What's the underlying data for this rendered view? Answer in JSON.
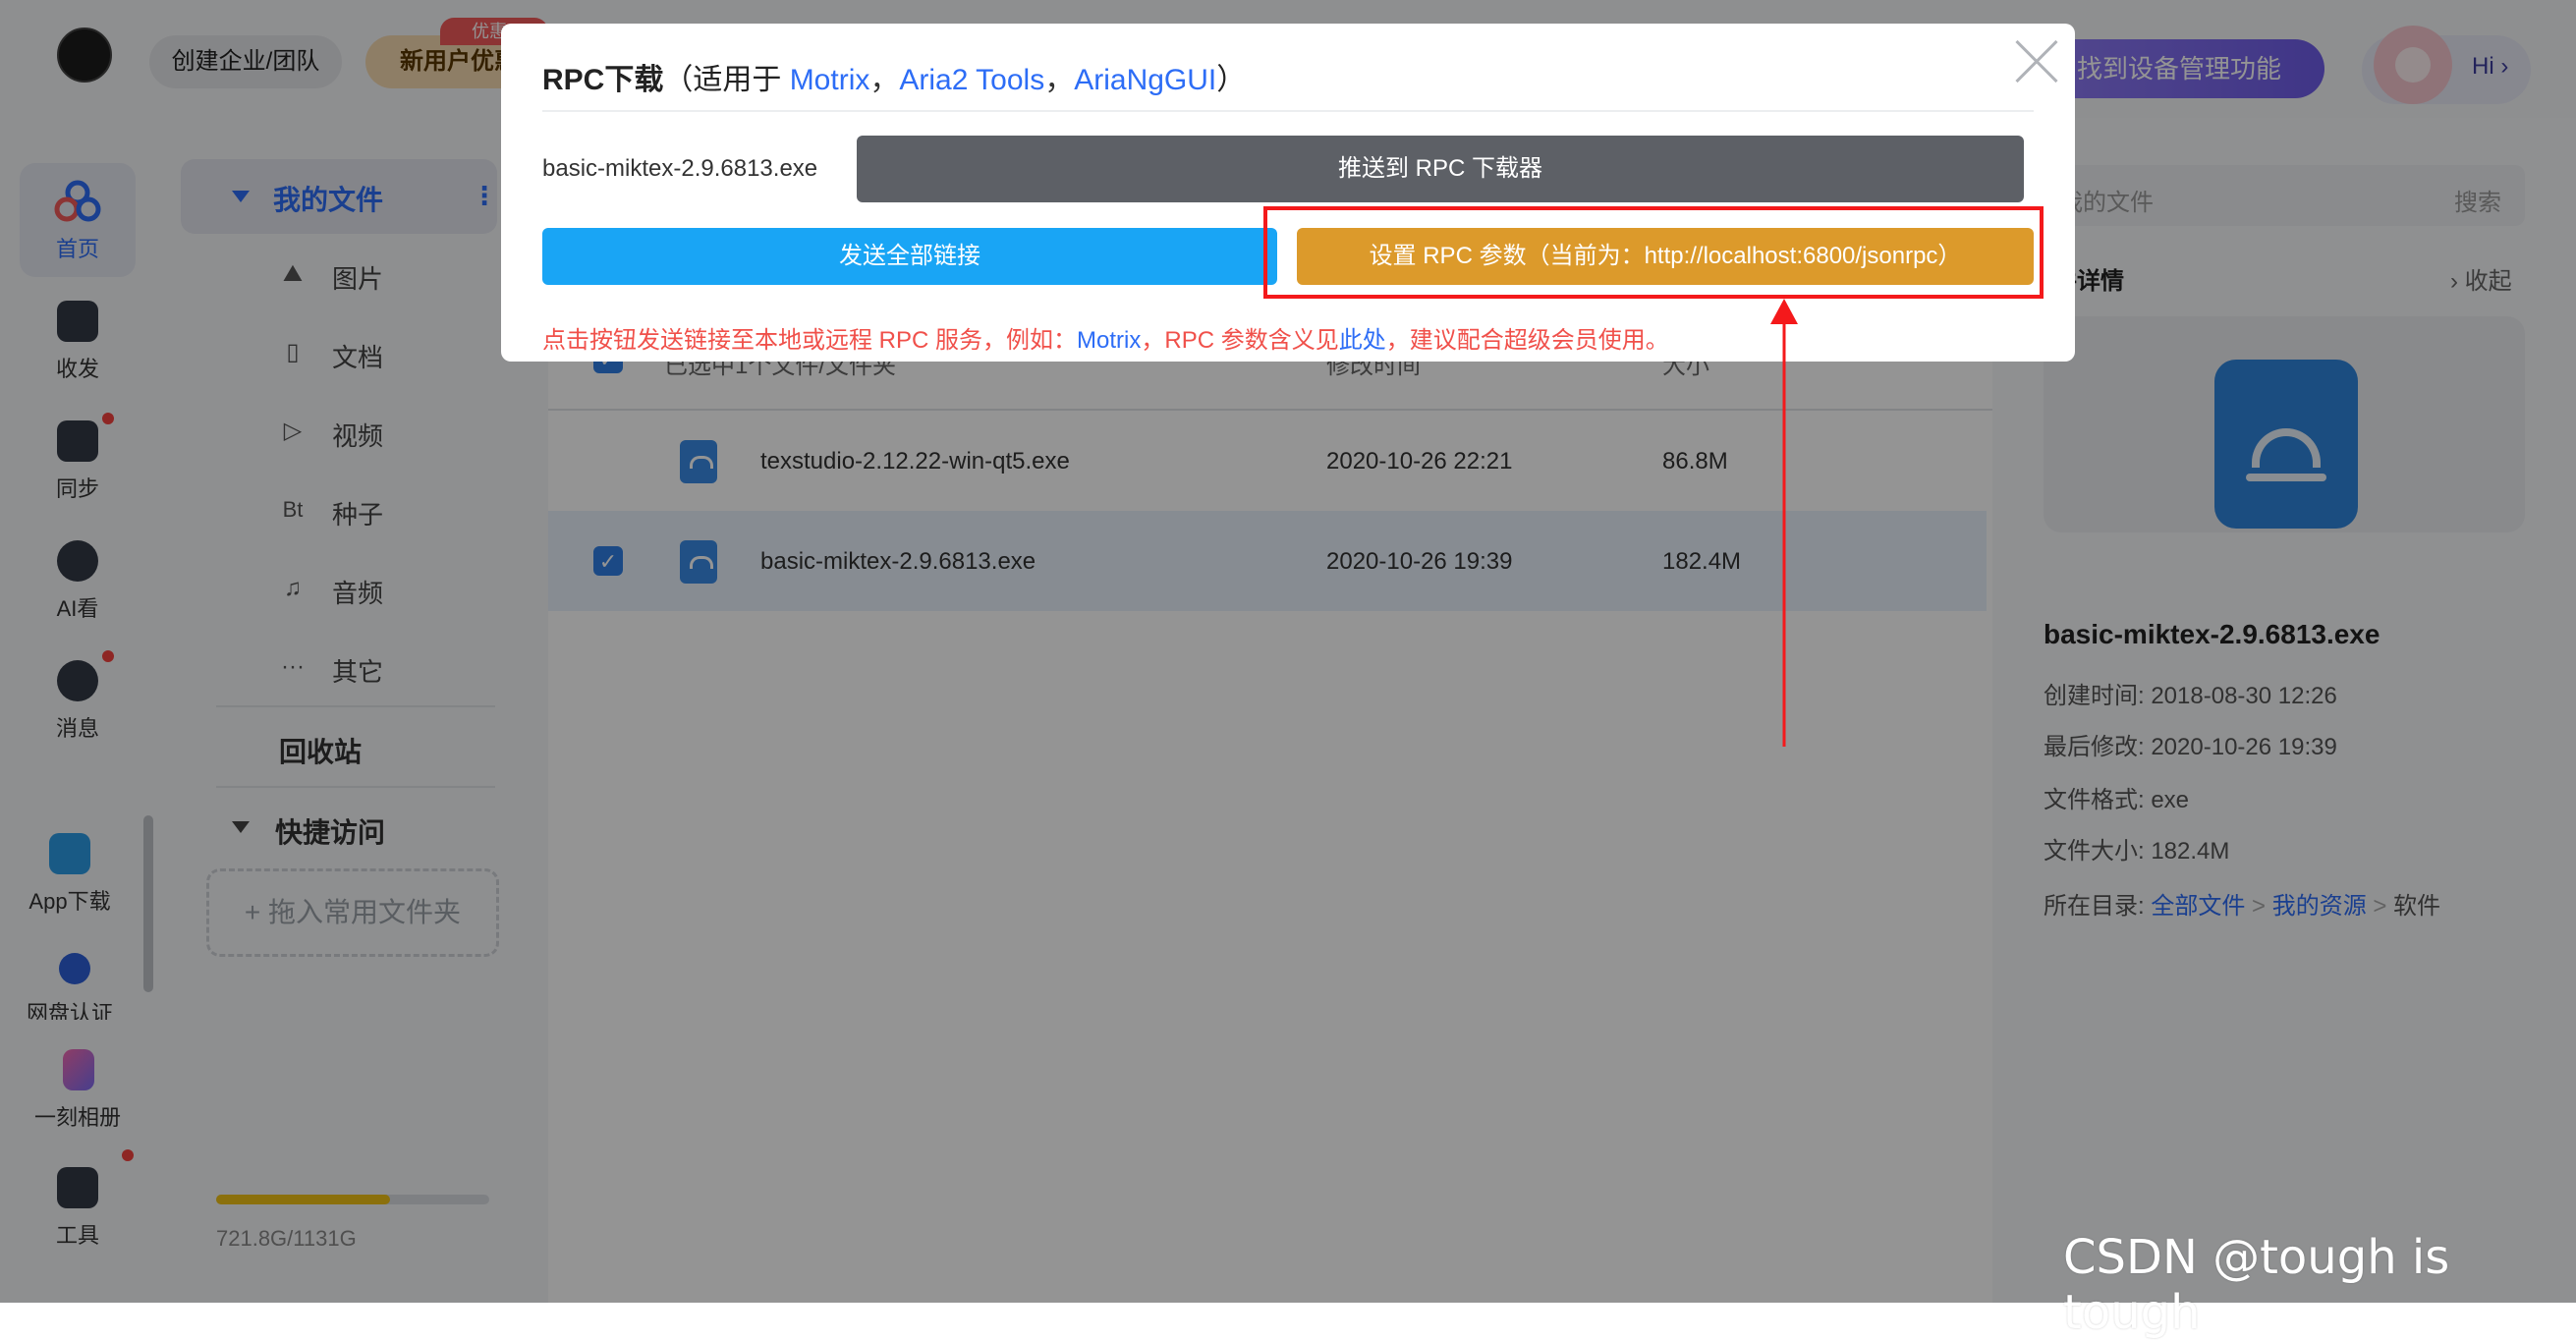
{
  "header": {
    "team_button": "创建企业/团队",
    "new_user_button": "新用户优惠",
    "promo_badge": "优惠¥",
    "find_device": "找到设备管理功能",
    "hi": "Hi ›"
  },
  "nav": {
    "items": [
      {
        "label": "首页",
        "icon": "home-cloud-icon"
      },
      {
        "label": "收发",
        "icon": "share-icon"
      },
      {
        "label": "同步",
        "icon": "sync-icon"
      },
      {
        "label": "AI看",
        "icon": "ai-icon"
      },
      {
        "label": "消息",
        "icon": "message-icon"
      },
      {
        "label": "App下载",
        "icon": "app-download-icon"
      },
      {
        "label": "网盘认证",
        "icon": "verify-icon"
      },
      {
        "label": "一刻相册",
        "icon": "album-icon"
      },
      {
        "label": "工具",
        "icon": "tools-icon"
      }
    ]
  },
  "tree": {
    "my_files": "我的文件",
    "more": "⋮",
    "categories": [
      {
        "label": "图片",
        "glyph": "⛰"
      },
      {
        "label": "文档",
        "glyph": "▯"
      },
      {
        "label": "视频",
        "glyph": "▷"
      },
      {
        "label": "种子",
        "glyph": "Bt"
      },
      {
        "label": "音频",
        "glyph": "♫"
      },
      {
        "label": "其它",
        "glyph": "···"
      }
    ],
    "recycle": "回收站",
    "quick_access": "快捷访问",
    "drop_hint": "+ 拖入常用文件夹",
    "quota": "721.8G/1131G",
    "quota_used_ratio": 0.638
  },
  "list": {
    "header_selected": "已选中1个文件/文件夹",
    "header_modified": "修改时间",
    "header_size": "大小",
    "rows": [
      {
        "name": "texstudio-2.12.22-win-qt5.exe",
        "modified": "2020-10-26 22:21",
        "size": "86.8M",
        "selected": false
      },
      {
        "name": "basic-miktex-2.9.6813.exe",
        "modified": "2020-10-26 19:39",
        "size": "182.4M",
        "selected": true
      }
    ]
  },
  "right": {
    "search_placeholder": "我的文件",
    "search_button": "搜索",
    "details_title": "件详情",
    "collapse": "› 收起",
    "file_name": "basic-miktex-2.9.6813.exe",
    "created": "创建时间: 2018-08-30 12:26",
    "modified": "最后修改: 2020-10-26 19:39",
    "format": "文件格式: exe",
    "size": "文件大小: 182.4M",
    "location_label": "所在目录: ",
    "location_path": [
      "全部文件",
      "我的资源",
      "软件"
    ],
    "path_sep": ">"
  },
  "modal": {
    "title": "RPC下载",
    "title_prefix": "（适用于 ",
    "clients": [
      "Motrix",
      "Aria2 Tools",
      "AriaNgGUI"
    ],
    "sep": "，",
    "title_suffix": "）",
    "file_name": "basic-miktex-2.9.6813.exe",
    "push_button": "推送到 RPC 下载器",
    "send_all_button": "发送全部链接",
    "rpc_settings_button": "设置 RPC 参数（当前为：http://localhost:6800/jsonrpc）",
    "note_a": "点击按钮发送链接至本地或远程 RPC 服务，例如：",
    "note_link1": "Motrix",
    "note_b": "，RPC 参数含义见",
    "note_link2": "此处",
    "note_c": "，建议配合超级会员使用。"
  },
  "watermark": "CSDN @tough is tough",
  "colors": {
    "accent": "#2d6df6",
    "send_button": "#19a5f5",
    "rpc_button": "#dc9a2b",
    "push_button": "#5d6066",
    "annotation": "#f4191b"
  }
}
